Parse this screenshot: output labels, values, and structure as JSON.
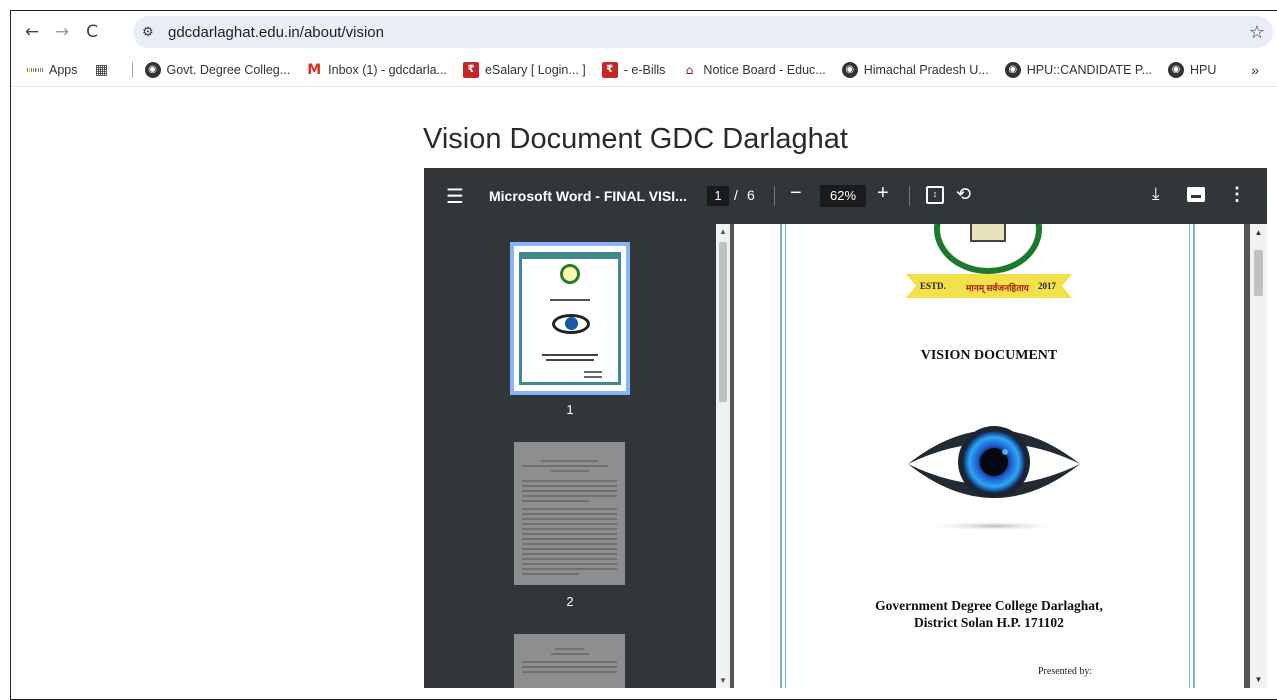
{
  "browser": {
    "url": "gdcdarlaghat.edu.in/about/vision",
    "bookmarks": [
      {
        "label": "Apps",
        "icon": "apps-grid-icon"
      },
      {
        "label": "Govt. Degree Colleg...",
        "icon": "globe-icon"
      },
      {
        "label": "Inbox (1) - gdcdarla...",
        "icon": "gmail-icon"
      },
      {
        "label": "eSalary [ Login... ]",
        "icon": "esalary-icon"
      },
      {
        "label": "- e-Bills",
        "icon": "ebills-icon"
      },
      {
        "label": "Notice Board - Educ...",
        "icon": "notice-icon"
      },
      {
        "label": "Himachal Pradesh U...",
        "icon": "globe-icon"
      },
      {
        "label": "HPU::CANDIDATE P...",
        "icon": "globe-icon"
      },
      {
        "label": "HPU",
        "icon": "globe-icon"
      }
    ],
    "more": "»"
  },
  "page": {
    "title": "Vision Document GDC Darlaghat"
  },
  "viewer": {
    "doc_title": "Microsoft Word - FINAL VISI...",
    "page_current": "1",
    "page_sep": "/",
    "page_total": "6",
    "zoom": "62%",
    "thumbnails": [
      {
        "label": "1"
      },
      {
        "label": "2"
      }
    ]
  },
  "document": {
    "emblem_left": "ESTD.",
    "emblem_motto": "मानम् सर्वजनहिताय",
    "emblem_year": "2017",
    "heading": "VISION DOCUMENT",
    "college_line1": "Government Degree College Darlaghat,",
    "college_line2": "District Solan H.P. 171102",
    "presented_by": "Presented by:"
  }
}
